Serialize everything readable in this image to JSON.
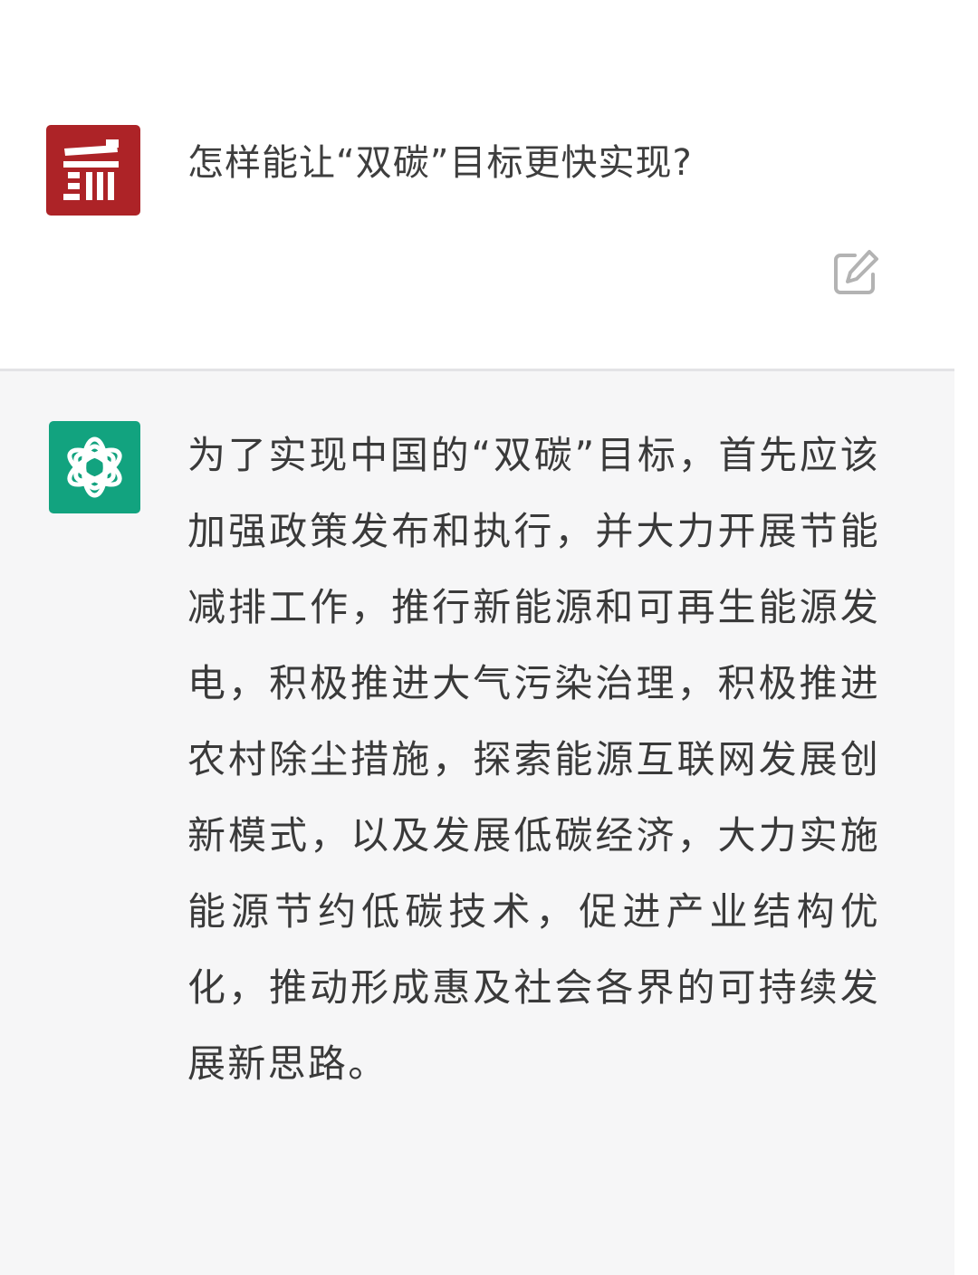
{
  "conversation": {
    "user_message": {
      "avatar_icon": "red-building-logo-icon",
      "text": "怎样能让“双碳”目标更快实现?",
      "edit_icon": "edit-icon"
    },
    "assistant_message": {
      "avatar_icon": "openai-logo-icon",
      "text": "为了实现中国的“双碳”目标，首先应该加强政策发布和执行，并大力开展节能减排工作，推行新能源和可再生能源发电，积极推进大气污染治理，积极推进农村除尘措施，探索能源互联网发展创新模式，以及发展低碳经济，大力实施能源节约低碳技术，促进产业结构优化，推动形成惠及社会各界的可持续发展新思路。"
    }
  },
  "colors": {
    "user_avatar_bg": "#ad2327",
    "assistant_avatar_bg": "#12a37f",
    "assistant_row_bg": "#f6f6f7"
  }
}
